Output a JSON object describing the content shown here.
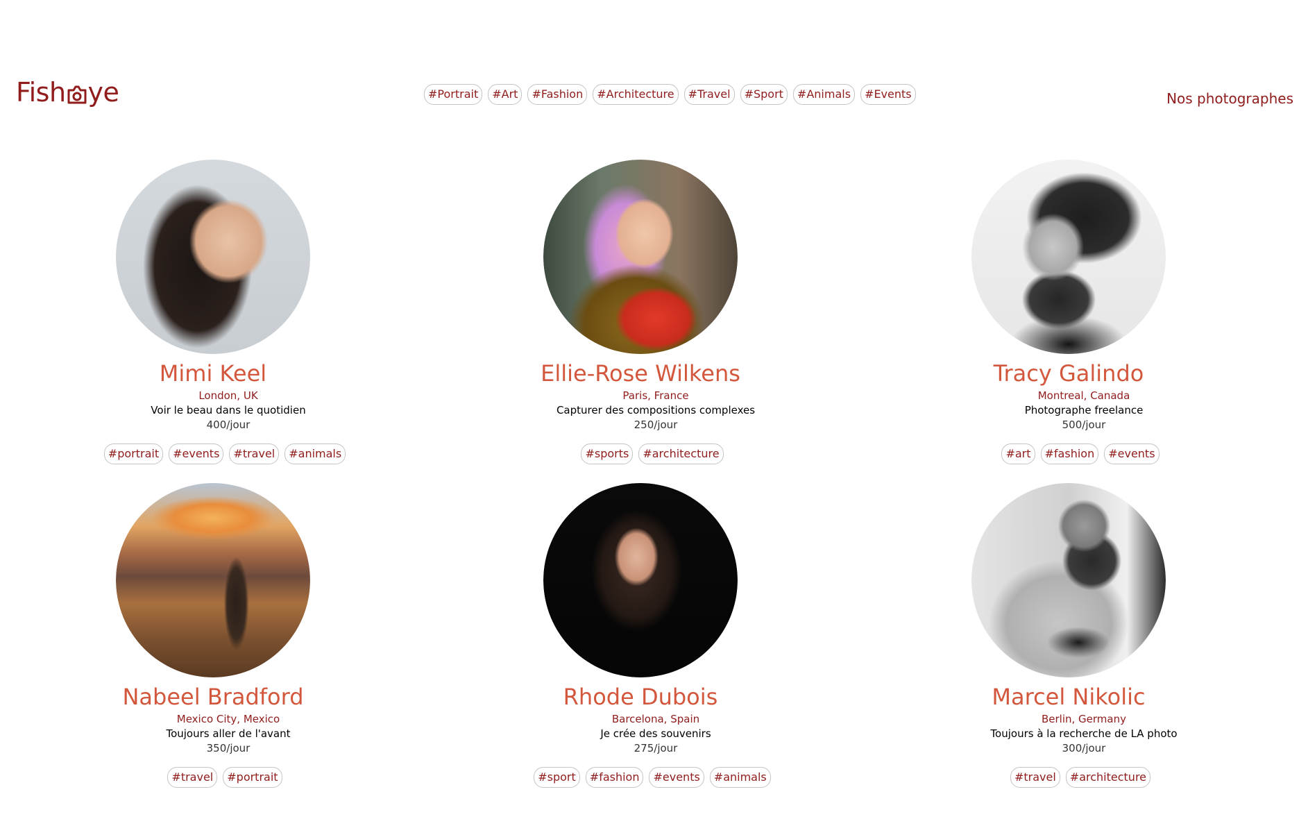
{
  "header": {
    "logo_text_left": "Fish",
    "logo_text_right": "ye",
    "logo_icon": "camera-icon",
    "nav_link": "Nos photographes",
    "tags": [
      "#Portrait",
      "#Art",
      "#Fashion",
      "#Architecture",
      "#Travel",
      "#Sport",
      "#Animals",
      "#Events"
    ]
  },
  "colors": {
    "brand": "#901c1c",
    "accent": "#d3573c",
    "background": "#ffffff"
  },
  "photographers": [
    {
      "name": "Mimi Keel",
      "location": "London, UK",
      "tagline": "Voir le beau dans le quotidien",
      "price": "400/jour",
      "tags": [
        "#portrait",
        "#events",
        "#travel",
        "#animals"
      ]
    },
    {
      "name": "Ellie-Rose Wilkens",
      "location": "Paris, France",
      "tagline": "Capturer des compositions complexes",
      "price": "250/jour",
      "tags": [
        "#sports",
        "#architecture"
      ]
    },
    {
      "name": "Tracy Galindo",
      "location": "Montreal, Canada",
      "tagline": "Photographe freelance",
      "price": "500/jour",
      "tags": [
        "#art",
        "#fashion",
        "#events"
      ]
    },
    {
      "name": "Nabeel Bradford",
      "location": "Mexico City, Mexico",
      "tagline": "Toujours aller de l'avant",
      "price": "350/jour",
      "tags": [
        "#travel",
        "#portrait"
      ]
    },
    {
      "name": "Rhode Dubois",
      "location": "Barcelona, Spain",
      "tagline": "Je crée des souvenirs",
      "price": "275/jour",
      "tags": [
        "#sport",
        "#fashion",
        "#events",
        "#animals"
      ]
    },
    {
      "name": "Marcel Nikolic",
      "location": "Berlin, Germany",
      "tagline": "Toujours à la recherche de LA photo",
      "price": "300/jour",
      "tags": [
        "#travel",
        "#architecture"
      ]
    }
  ]
}
